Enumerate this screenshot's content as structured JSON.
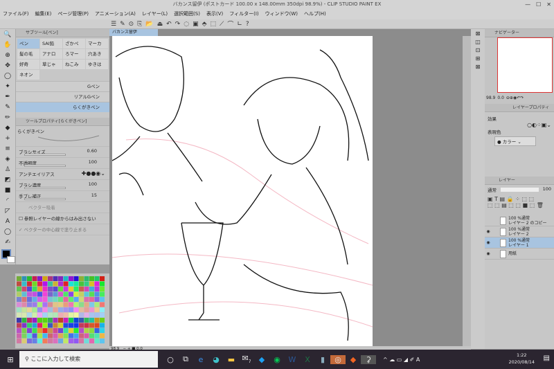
{
  "window": {
    "title": "バカンス留伊 (ポストカード 100.00 x 148.00mm 350dpi 98.9%) - CLIP STUDIO PAINT EX",
    "minimize": "—",
    "maximize": "☐",
    "close": "✕"
  },
  "menu": [
    "ファイル(F)",
    "編集(E)",
    "ページ管理(P)",
    "アニメーション(A)",
    "レイヤー(L)",
    "選択範囲(S)",
    "表示(V)",
    "フィルター(I)",
    "ウィンドウ(W)",
    "ヘルプ(H)"
  ],
  "toolbar_icons": [
    "☰",
    "✎",
    "⊙",
    "⎘",
    "📂",
    "⏏",
    "↶",
    "↷",
    "◌",
    "▣",
    "⬘",
    "⬚",
    "⟋",
    "⌒",
    "∟",
    "?"
  ],
  "tools": [
    "🔍",
    "✋",
    "⊕",
    "✥",
    "◯",
    "✦",
    "✒",
    "✎",
    "✏",
    "◆",
    "+",
    "≡",
    "◈",
    "♙",
    "◩",
    "■",
    "◜",
    "◸",
    "A",
    "◯",
    "✍"
  ],
  "subtool": {
    "tab": "サブツール[ペン]",
    "items": [
      "ペン",
      "SAI鉛",
      "ざかペ",
      "マーカ",
      "髪の毛",
      "アナロ",
      "ろマー",
      "穴あき",
      "好奇",
      "草じゃ",
      "ねこみ",
      "ゆきは",
      "ネオン"
    ],
    "brushes": [
      "Gペン",
      "リアルGペン",
      "らくがきペン"
    ]
  },
  "props": {
    "tab": "ツールプロパティ[らくがきペン]",
    "brush_name": "らくがきペン",
    "brush_size_label": "ブラシサイズ",
    "brush_size": "0.60",
    "opacity_label": "不透明度",
    "opacity": "100",
    "antialias_label": "アンチエイリアス",
    "density_label": "ブラシ濃度",
    "density": "100",
    "stabilize_label": "手ブレ補正",
    "stabilize": "15",
    "vector_snap": "ベクター吸着",
    "ref_layer": "参照レイヤーの線からはみ出さない",
    "vector_center": "ベクターの中心線で塗り止まる"
  },
  "canvas": {
    "doc_tab": "バカンス留伊",
    "zoom": "98.9",
    "angle": "0.0"
  },
  "navigator": {
    "tab": "ナビゲーター",
    "zoom": "98.9",
    "angle": "0.0"
  },
  "layer_props": {
    "tab": "レイヤープロパティ",
    "effect_label": "効果",
    "color_label": "表現色",
    "color_value": "カラー"
  },
  "layers": {
    "tab": "レイヤー",
    "blend": "通常",
    "opacity": "100",
    "items": [
      {
        "mode": "100 %通常",
        "name": "レイヤー 2 のコピー",
        "visible": false,
        "selected": false
      },
      {
        "mode": "100 %通常",
        "name": "レイヤー 2",
        "visible": true,
        "selected": false
      },
      {
        "mode": "100 %通常",
        "name": "レイヤー 1",
        "visible": true,
        "selected": true
      },
      {
        "mode": "",
        "name": "用紙",
        "visible": true,
        "selected": false
      }
    ]
  },
  "taskbar": {
    "search": "ここに入力して検索",
    "time": "1:22",
    "date": "2020/08/14",
    "mail_badge": "7"
  },
  "colors": {
    "accent": "#a8c4e0",
    "taskbar": "#2b2530"
  }
}
